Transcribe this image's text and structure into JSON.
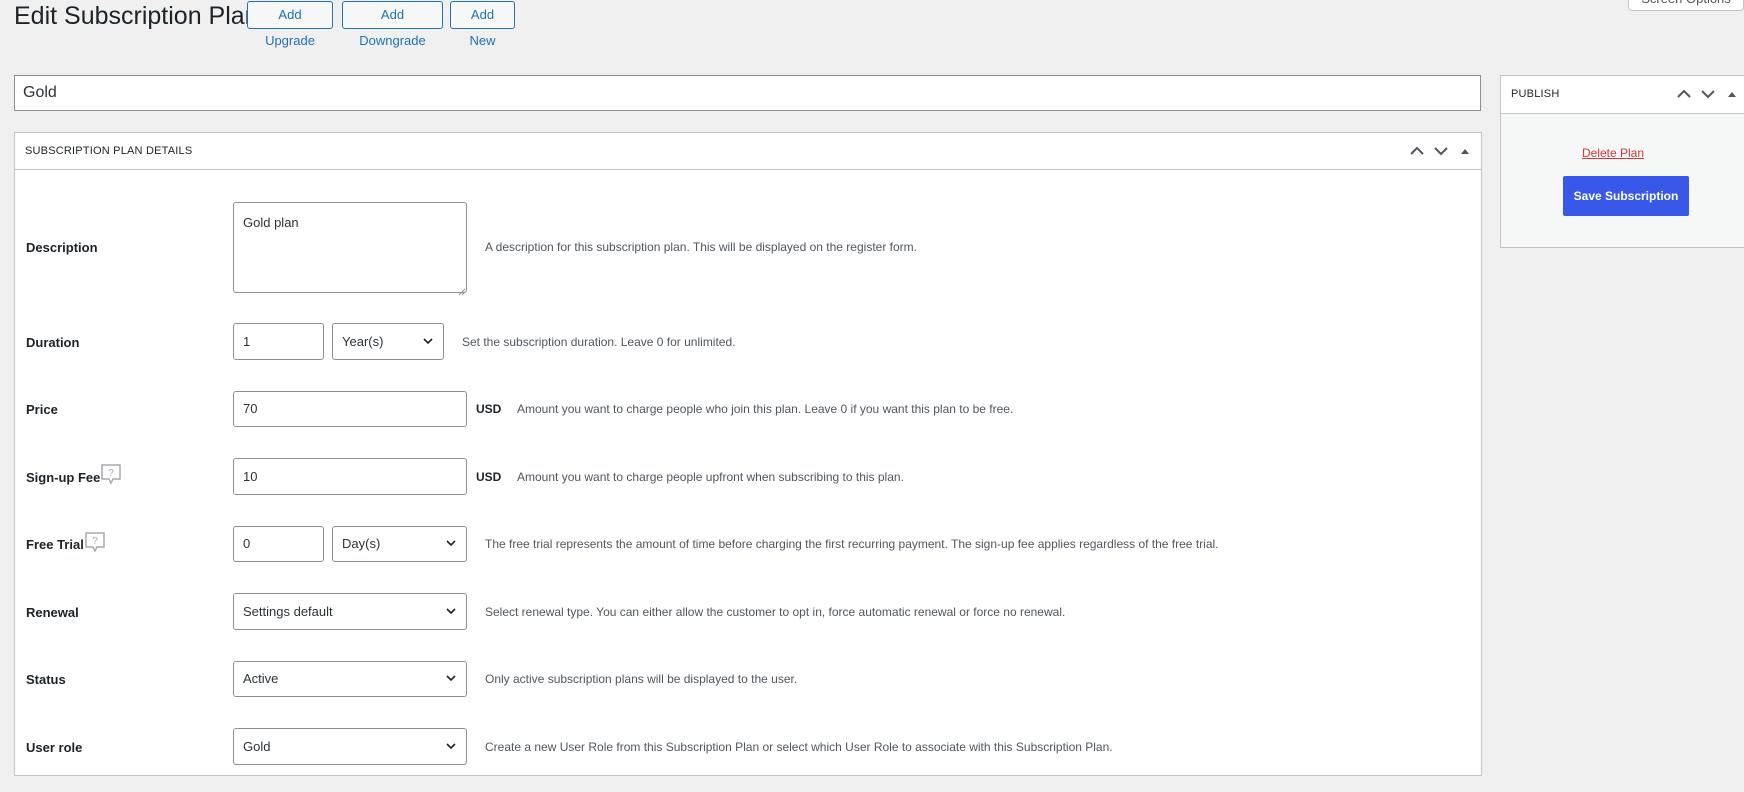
{
  "page": {
    "title": "Edit Subscription Plan",
    "buttons": {
      "add_upgrade": "Add Upgrade",
      "add_downgrade": "Add Downgrade",
      "add_new": "Add New"
    },
    "screen_options": "Screen Options"
  },
  "plan_name": "Gold",
  "details": {
    "heading": "SUBSCRIPTION PLAN DETAILS",
    "description": {
      "label": "Description",
      "value": "Gold plan",
      "help": "A description for this subscription plan. This will be displayed on the register form."
    },
    "duration": {
      "label": "Duration",
      "value": "1",
      "unit": "Year(s)",
      "help": "Set the subscription duration. Leave 0 for unlimited."
    },
    "price": {
      "label": "Price",
      "value": "70",
      "currency": "USD",
      "help": "Amount you want to charge people who join this plan. Leave 0 if you want this plan to be free."
    },
    "signup_fee": {
      "label": "Sign-up Fee",
      "value": "10",
      "currency": "USD",
      "help": "Amount you want to charge people upfront when subscribing to this plan."
    },
    "free_trial": {
      "label": "Free Trial",
      "value": "0",
      "unit": "Day(s)",
      "help": "The free trial represents the amount of time before charging the first recurring payment. The sign-up fee applies regardless of the free trial."
    },
    "renewal": {
      "label": "Renewal",
      "value": "Settings default",
      "help": "Select renewal type. You can either allow the customer to opt in, force automatic renewal or force no renewal."
    },
    "status": {
      "label": "Status",
      "value": "Active",
      "help": "Only active subscription plans will be displayed to the user."
    },
    "user_role": {
      "label": "User role",
      "value": "Gold",
      "help": "Create a new User Role from this Subscription Plan or select which User Role to associate with this Subscription Plan."
    }
  },
  "publish": {
    "heading": "PUBLISH",
    "delete_label": "Delete Plan",
    "save_label": "Save Subscription"
  },
  "colors": {
    "accent": "#3858e9",
    "link": "#2271b1",
    "danger": "#d63638",
    "background": "#f0f0f1"
  }
}
